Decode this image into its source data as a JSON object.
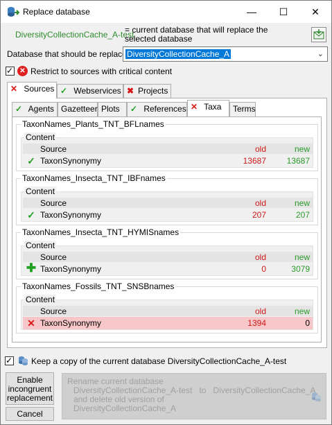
{
  "window": {
    "title": "Replace database"
  },
  "current": {
    "db_name": "DiversityCollectionCache_A-test",
    "description": "= current database that will replace the selected database"
  },
  "replace": {
    "label": "Database that should be replaced:",
    "selected": "DiversityCollectionCache_A"
  },
  "restrict": {
    "label": "Restrict to sources with critical content",
    "checked": true
  },
  "main_tabs": [
    {
      "label": "Sources"
    },
    {
      "label": "Webservices"
    },
    {
      "label": "Projects"
    }
  ],
  "sub_tabs": [
    {
      "label": "Agents"
    },
    {
      "label": "Gazetteer"
    },
    {
      "label": "Plots"
    },
    {
      "label": "References"
    },
    {
      "label": "Taxa"
    },
    {
      "label": "Terms"
    }
  ],
  "columns": {
    "content": "Content",
    "source": "Source",
    "old": "old",
    "new": "new"
  },
  "groups": [
    {
      "title": "TaxonNames_Plants_TNT_BFLnames",
      "row": {
        "status": "ok",
        "name": "TaxonSynonymy",
        "old": "13687",
        "new": "13687"
      }
    },
    {
      "title": "TaxonNames_Insecta_TNT_IBFnames",
      "row": {
        "status": "ok",
        "name": "TaxonSynonymy",
        "old": "207",
        "new": "207"
      }
    },
    {
      "title": "TaxonNames_Insecta_TNT_HYMISnames",
      "row": {
        "status": "add",
        "name": "TaxonSynonymy",
        "old": "0",
        "new": "3079"
      }
    },
    {
      "title": "TaxonNames_Fossils_TNT_SNSBnames",
      "row": {
        "status": "error",
        "name": "TaxonSynonymy",
        "old": "1394",
        "new": "0"
      }
    }
  ],
  "keep_copy": {
    "label": "Keep a copy of the current database DiversityCollectionCache_A-test",
    "checked": true
  },
  "buttons": {
    "enable_line1": "Enable",
    "enable_line2": "incongruent",
    "enable_line3": "replacement",
    "cancel": "Cancel",
    "rename_line1": "Rename current database",
    "rename_line2": "DiversityCollectionCache_A-test   to   DiversityCollectionCache_A",
    "rename_line3": "and delete old version of",
    "rename_line4": "DiversityCollectionCache_A"
  }
}
